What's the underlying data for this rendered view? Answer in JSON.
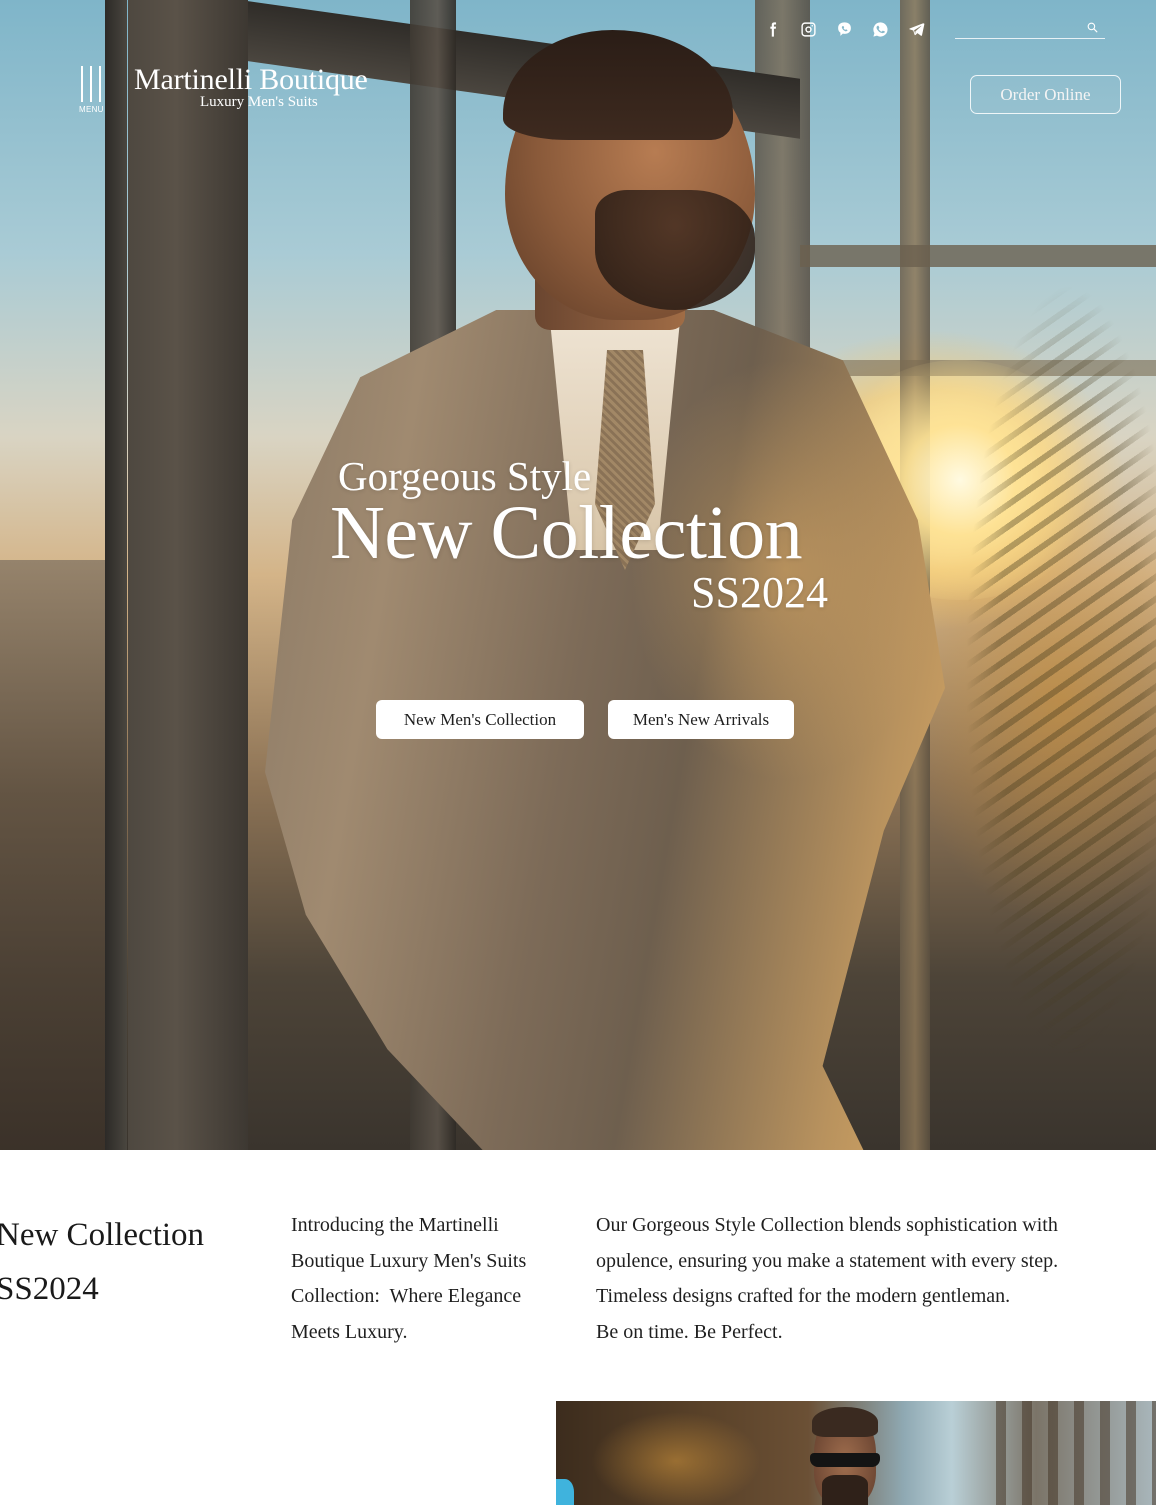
{
  "header": {
    "menu_label": "MENU",
    "brand_name": "Martinelli Boutique",
    "brand_tagline": "Luxury Men's Suits",
    "order_button": "Order Online",
    "search": {
      "value": "",
      "placeholder": ""
    },
    "social_icons": [
      "facebook-icon",
      "instagram-icon",
      "viber-icon",
      "whatsapp-icon",
      "telegram-icon"
    ]
  },
  "hero": {
    "kicker": "Gorgeous Style",
    "title": "New Collection",
    "season": "SS2024",
    "buttons": [
      {
        "label": "New Men's Collection"
      },
      {
        "label": "Men's New Arrivals"
      }
    ]
  },
  "intro": {
    "title_lines": [
      "New Collection",
      "SS2024"
    ],
    "column1_lines": [
      "Introducing the Martinelli",
      "Boutique Luxury Men's Suits",
      "Collection:  Where Elegance",
      "Meets Luxury."
    ],
    "column2_lines": [
      "Our Gorgeous Style Collection blends sophistication with",
      "opulence, ensuring you make a statement with every step.",
      "Timeless designs crafted for the modern gentleman.",
      "Be on time. Be Perfect."
    ]
  },
  "colors": {
    "text_dark": "#1a1a1a",
    "hero_text": "#ffffff",
    "button_bg": "#ffffff",
    "page_bg": "#ffffff"
  }
}
